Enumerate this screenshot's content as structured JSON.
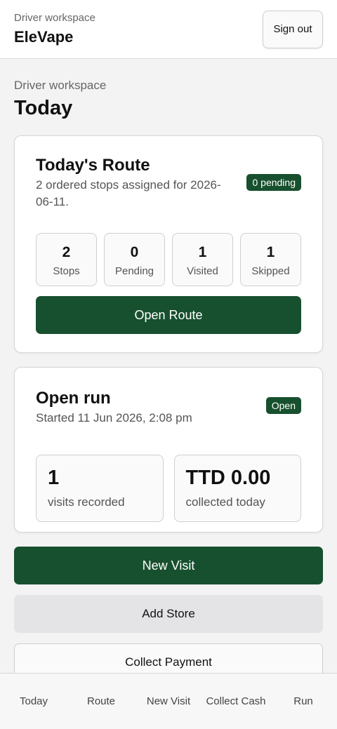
{
  "header": {
    "subtitle": "Driver workspace",
    "title": "EleVape",
    "signout_label": "Sign out"
  },
  "page": {
    "subtitle": "Driver workspace",
    "title": "Today"
  },
  "route_card": {
    "title": "Today's Route",
    "description": "2 ordered stops assigned for 2026-06-11.",
    "badge": "0 pending",
    "stats": [
      {
        "value": "2",
        "label": "Stops"
      },
      {
        "value": "0",
        "label": "Pending"
      },
      {
        "value": "1",
        "label": "Visited"
      },
      {
        "value": "1",
        "label": "Skipped"
      }
    ],
    "button_label": "Open Route"
  },
  "run_card": {
    "title": "Open run",
    "description": "Started 11 Jun 2026, 2:08 pm",
    "badge": "Open",
    "stats": [
      {
        "value": "1",
        "label": "visits recorded"
      },
      {
        "value": "TTD 0.00",
        "label": "collected today"
      }
    ]
  },
  "actions": {
    "new_visit": "New Visit",
    "add_store": "Add Store",
    "collect_payment": "Collect Payment"
  },
  "bottom_nav": {
    "items": [
      {
        "label": "Today"
      },
      {
        "label": "Route"
      },
      {
        "label": "New Visit"
      },
      {
        "label": "Collect Cash"
      },
      {
        "label": "Run"
      }
    ]
  },
  "colors": {
    "primary": "#17502e",
    "secondary_button": "#e4e4e6",
    "background": "#f3f3f3"
  }
}
